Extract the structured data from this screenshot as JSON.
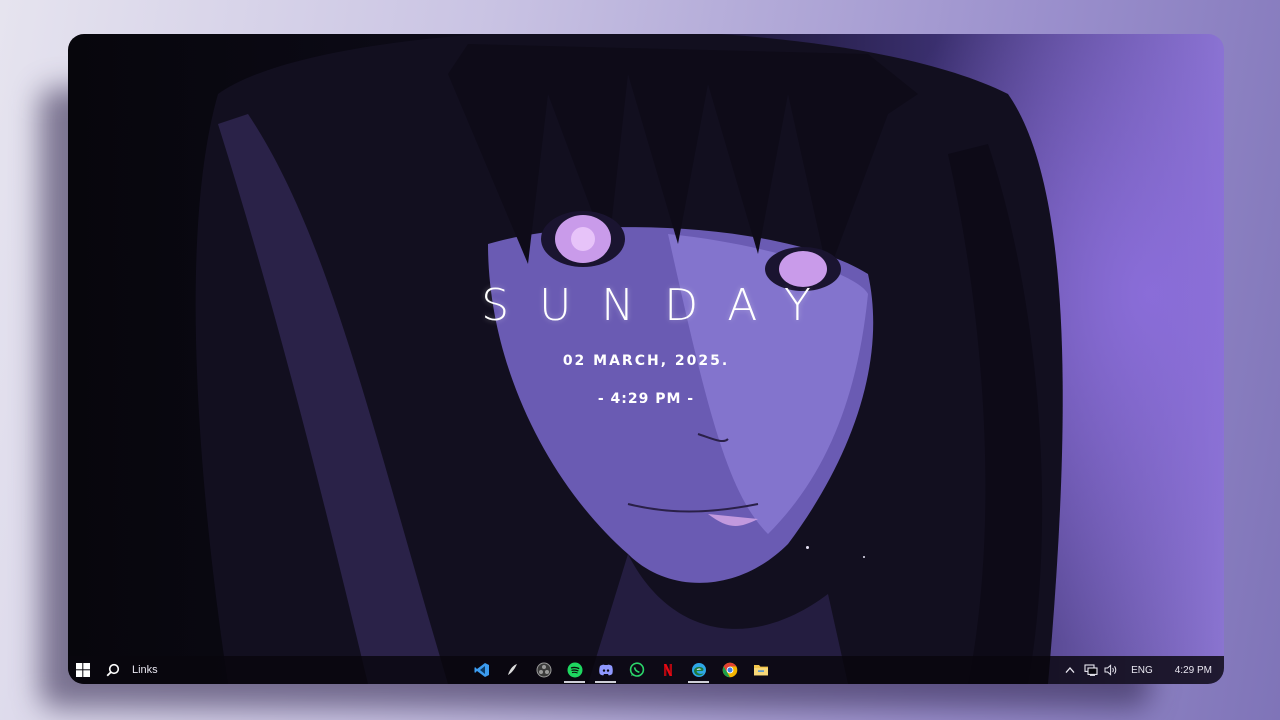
{
  "lockscreen": {
    "day": "SUNDAY",
    "date": "02 MARCH, 2025.",
    "time": "- 4:29 PM -"
  },
  "taskbar": {
    "links_label": "Links",
    "apps": [
      {
        "name": "vscode-icon",
        "color": "#3c9cf0",
        "running": false
      },
      {
        "name": "pen-icon",
        "color": "#d8d8d8",
        "running": false
      },
      {
        "name": "obs-icon",
        "color": "#9a9a9a",
        "running": false
      },
      {
        "name": "spotify-icon",
        "color": "#1ed760",
        "running": true
      },
      {
        "name": "discord-icon",
        "color": "#8f98ff",
        "running": true
      },
      {
        "name": "whatsapp-icon",
        "color": "#2bd56a",
        "running": false
      },
      {
        "name": "netflix-icon",
        "color": "#e50914",
        "running": false
      },
      {
        "name": "edge-icon",
        "color": "#2ea7e6",
        "running": true
      },
      {
        "name": "chrome-icon",
        "color": "#f2b400",
        "running": false
      },
      {
        "name": "file-explorer-icon",
        "color": "#f3c64b",
        "running": false
      }
    ],
    "tray": {
      "language": "ENG",
      "time": "4:29 PM"
    }
  },
  "colors": {
    "accent": "#8a74d0",
    "taskbar_bg": "#08060e"
  }
}
